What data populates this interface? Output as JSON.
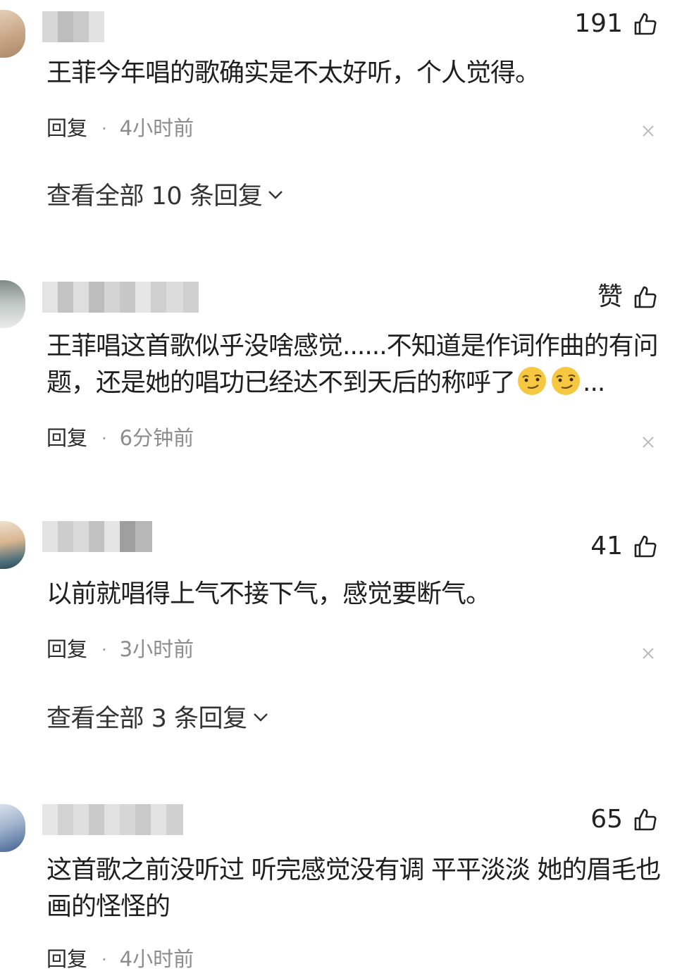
{
  "comments": [
    {
      "like_label": "191",
      "text": "王菲今年唱的歌确实是不太好听，个人觉得。",
      "reply_label": "回复",
      "time": "4小时前",
      "view_replies": "查看全部 10 条回复"
    },
    {
      "like_label": "赞",
      "text": "王菲唱这首歌似乎没啥感觉......不知道是作词作曲的有问题，还是她的唱功已经达不到天后的称呼了",
      "text_suffix": "...",
      "emoji_icons": [
        "smirk-emoji-icon",
        "smirk-emoji-icon"
      ],
      "reply_label": "回复",
      "time": "6分钟前"
    },
    {
      "like_label": "41",
      "text": "以前就唱得上气不接下气，感觉要断气。",
      "reply_label": "回复",
      "time": "3小时前",
      "view_replies": "查看全部 3 条回复"
    },
    {
      "like_label": "65",
      "text": "这首歌之前没听过 听完感觉没有调 平平淡淡 她的眉毛也画的怪怪的",
      "reply_label": "回复",
      "time": "4小时前"
    }
  ],
  "icons": {
    "like": "thumbs-up-icon",
    "close": "close-icon",
    "expand": "chevron-down-icon"
  },
  "colors": {
    "text": "#1f1f1f",
    "meta": "#8c8c8c",
    "close": "#bcbcbc"
  }
}
